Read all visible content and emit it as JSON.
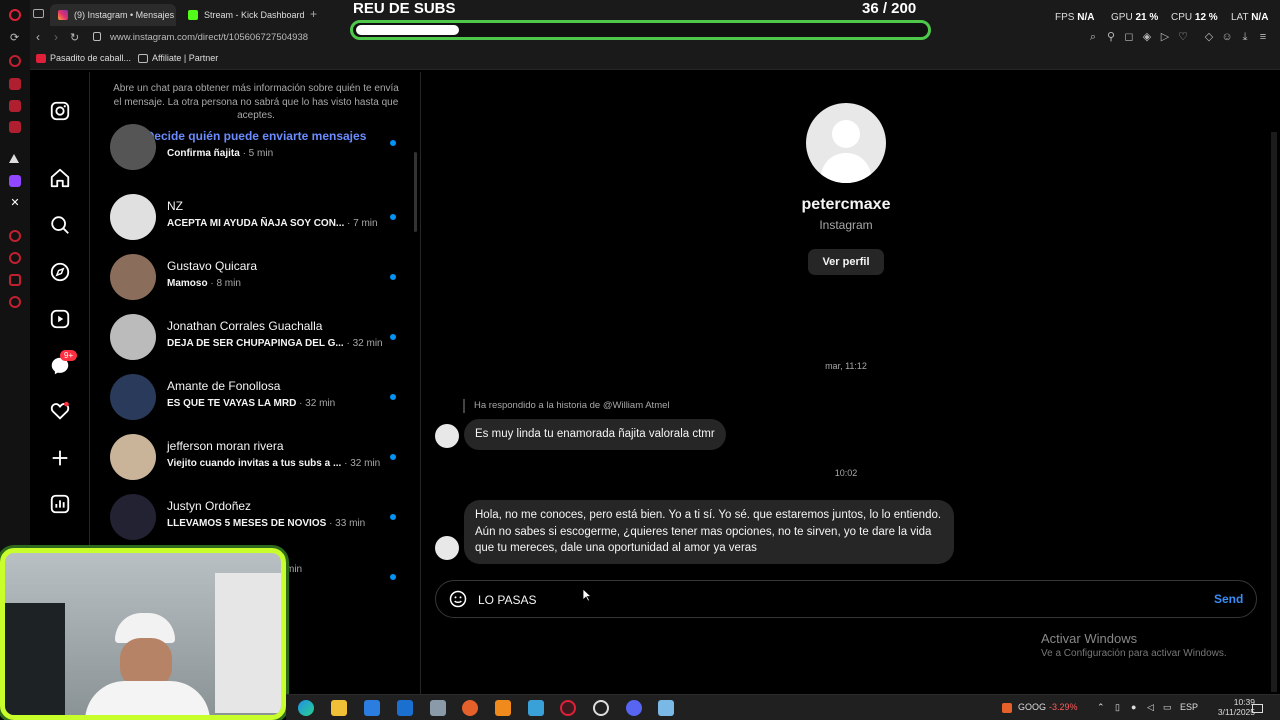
{
  "browser": {
    "tabs": [
      {
        "label": "(9) Instagram • Mensajes",
        "active": true
      },
      {
        "label": "Stream - Kick Dashboard",
        "active": false
      }
    ],
    "url": "www.instagram.com/direct/t/105606727504938",
    "bookmarks": [
      "Pasadito de caball...",
      "Affiliate | Partner"
    ]
  },
  "overlay": {
    "title": "REU DE SUBS",
    "count": "36  / 200",
    "progress": 0.18,
    "fps_label": "FPS",
    "fps_value": "N/A",
    "gpu_label": "GPU",
    "gpu_value": "21 %",
    "cpu_label": "CPU",
    "cpu_value": "12 %",
    "lat_label": "LAT",
    "lat_value": "N/A"
  },
  "nav": {
    "notifications_badge": "9+"
  },
  "chat_list": {
    "info_text": "Abre un chat para obtener más información sobre quién te envía el mensaje. La otra persona no sabrá que lo has visto hasta que aceptes.",
    "info_link": "Decide quién puede enviarte mensajes",
    "chats": [
      {
        "name": "",
        "preview": "Confirma ñajita",
        "time": "· 5 min"
      },
      {
        "name": "NZ",
        "preview": "ACEPTA MI AYUDA ÑAJA SOY CON...",
        "time": "· 7 min"
      },
      {
        "name": "Gustavo Quicara",
        "preview": "Mamoso",
        "time": "· 8 min"
      },
      {
        "name": "Jonathan Corrales Guachalla",
        "preview": "DEJA DE SER CHUPAPINGA DEL G...",
        "time": "· 32 min"
      },
      {
        "name": "Amante de Fonollosa",
        "preview": "ES QUE TE VAYAS LA MRD",
        "time": "· 32 min"
      },
      {
        "name": "jefferson moran rivera",
        "preview": "Viejito cuando invitas a tus subs a ...",
        "time": "· 32 min"
      },
      {
        "name": "Justyn Ordoñez",
        "preview": "LLEVAMOS 5 MESES DE NOVIOS",
        "time": "· 33 min"
      },
      {
        "name": "",
        "preview": "",
        "time": "min"
      }
    ]
  },
  "conversation": {
    "username": "petercmaxe",
    "platform": "Instagram",
    "profile_button": "Ver perfil",
    "timestamp1": "mar, 11:12",
    "story_reply": "Ha respondido a la historia de @William Atmel",
    "message1": "Es muy linda tu enamorada ñajita valorala ctmr",
    "timestamp2": "10:02",
    "message2": "Hola, no me conoces, pero está bien. Yo a ti sí. Yo sé. que estaremos juntos, lo lo entiendo. Aún no sabes si escogerme, ¿quieres tener mas opciones, no te sirven, yo te dare la vida que tu mereces, dale una oportunidad al amor ya veras",
    "composer_value": "LO PASAS",
    "send_label": "Send"
  },
  "windows": {
    "activate_title": "Activar Windows",
    "activate_sub": "Ve a Configuración para activar Windows.",
    "stock_symbol": "GOOG",
    "stock_change": "-3.29%",
    "language": "ESP",
    "time": "10:39",
    "date": "3/11/2025"
  },
  "colors": {
    "accent_blue": "#0095f6",
    "link_blue": "#6b8cff",
    "overlay_green": "#4ec84a",
    "webcam_border": "#c8ff2a"
  }
}
